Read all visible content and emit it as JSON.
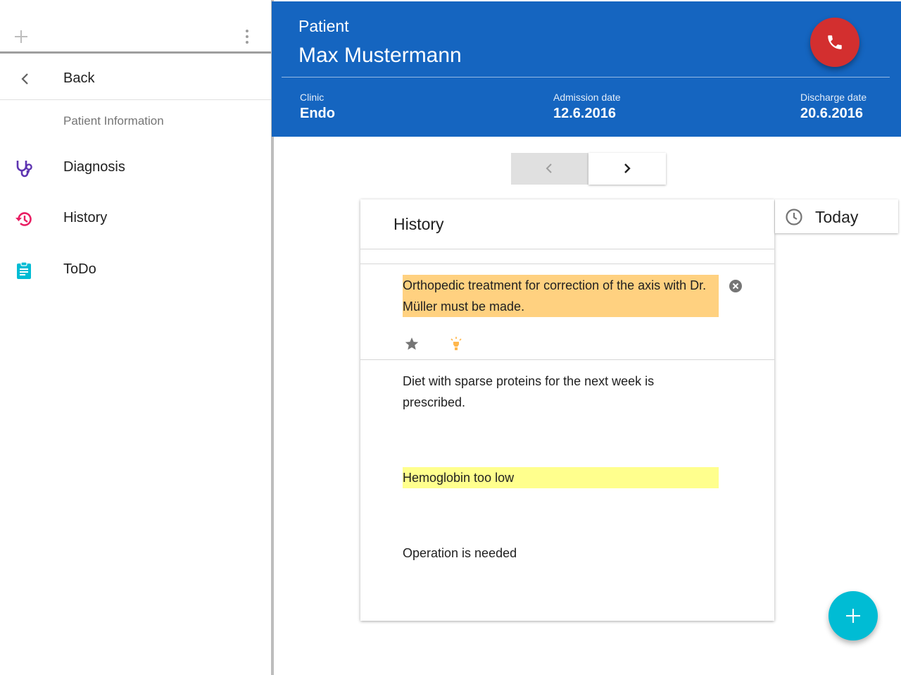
{
  "sidebar": {
    "back_label": "Back",
    "section_label": "Patient Information",
    "items": [
      {
        "label": "Diagnosis",
        "icon": "stethoscope-icon",
        "color": "#5e35b1"
      },
      {
        "label": "History",
        "icon": "history-icon",
        "color": "#e91e63"
      },
      {
        "label": "ToDo",
        "icon": "clipboard-icon",
        "color": "#00bcd4"
      }
    ]
  },
  "header": {
    "kicker": "Patient",
    "title": "Max Mustermann",
    "clinic_label": "Clinic",
    "clinic_value": "Endo",
    "admission_label": "Admission date",
    "admission_value": "12.6.2016",
    "discharge_label": "Discharge date",
    "discharge_value": "20.6.2016",
    "color": "#1565c0",
    "call_icon": "phone-icon",
    "call_color": "#d32f2f"
  },
  "card": {
    "title": "History",
    "notes": [
      {
        "text": "Orthopedic treatment for correction of the axis with Dr. Müller must be made.",
        "highlight": "#ffd180"
      },
      {
        "text": "Diet with sparse proteins for the next week is prescribed.",
        "highlight": ""
      },
      {
        "text": "Hemoglobin too low",
        "highlight": "#ffff8d"
      },
      {
        "text": "Operation is needed",
        "highlight": ""
      }
    ]
  },
  "today": {
    "label": "Today",
    "icon": "clock-icon"
  },
  "fab": {
    "icon": "plus-icon",
    "color": "#00bcd4"
  }
}
